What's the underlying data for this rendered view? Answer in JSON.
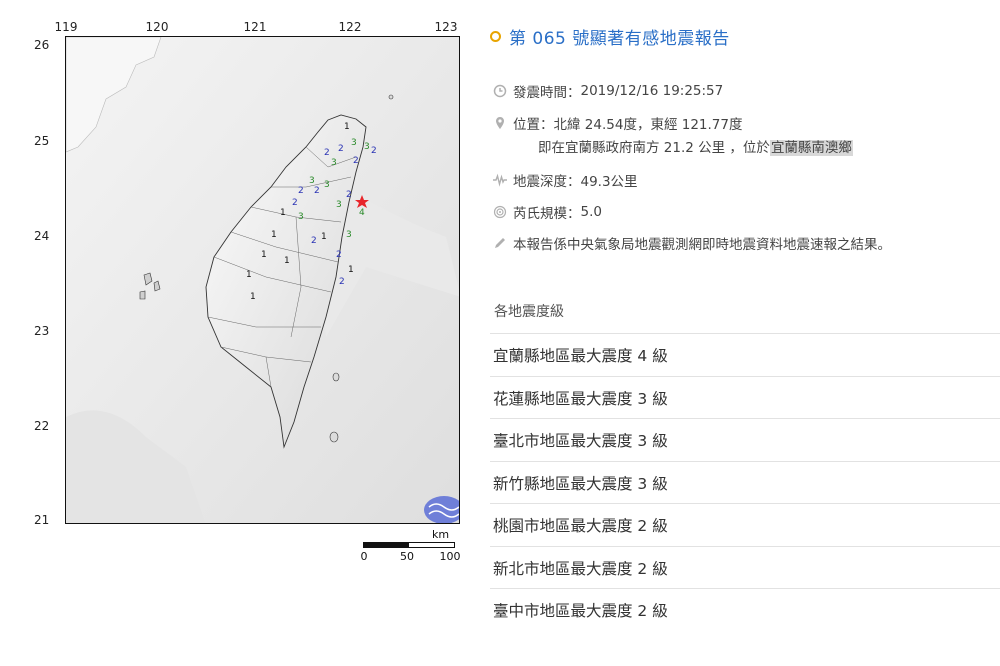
{
  "map": {
    "top_ticks": [
      "119",
      "120",
      "121",
      "122",
      "123"
    ],
    "left_ticks": [
      "26",
      "25",
      "24",
      "23",
      "22",
      "21"
    ],
    "scale": {
      "unit": "km",
      "labels": [
        "0",
        "50",
        "100"
      ]
    },
    "epicenter_color": "#e8262b",
    "intensity_labels": [
      "1",
      "2",
      "3",
      "4"
    ]
  },
  "report": {
    "title": "第 065 號顯著有感地震報告",
    "time_label": "發震時間：",
    "time_value": "2019/12/16 19:25:57",
    "location_label": "位置：",
    "location_value": "北緯 24.54度，東經 121.77度",
    "location_detail": "即在宜蘭縣政府南方 21.2 公里 ，位於",
    "location_town": "宜蘭縣南澳鄉",
    "depth_label": "地震深度：",
    "depth_value": "49.3公里",
    "magnitude_label": "芮氏規模：",
    "magnitude_value": "5.0",
    "note": "本報告係中央氣象局地震觀測網即時地震資料地震速報之結果。",
    "section_title": "各地震度級",
    "levels": [
      "宜蘭縣地區最大震度 4 級",
      "花蓮縣地區最大震度 3 級",
      "臺北市地區最大震度 3 級",
      "新竹縣地區最大震度 3 級",
      "桃園市地區最大震度 2 級",
      "新北市地區最大震度 2 級",
      "臺中市地區最大震度 2 級"
    ],
    "colors": {
      "title": "#2a6fc7",
      "dot": "#e8a400",
      "icon": "#b0b0b0"
    }
  }
}
